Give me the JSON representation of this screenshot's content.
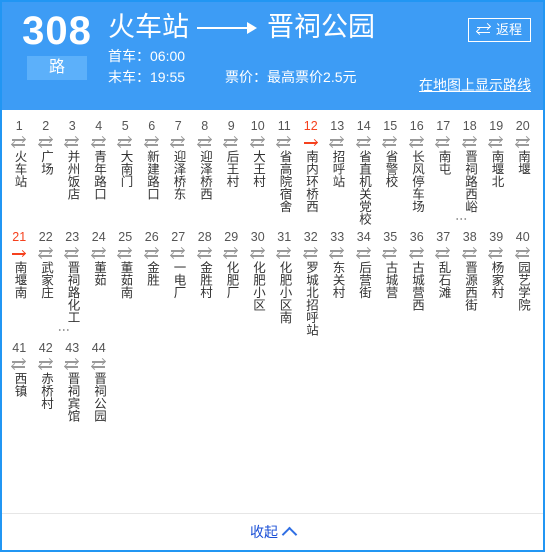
{
  "header": {
    "route_number": "308",
    "route_suffix": "路",
    "origin": "火车站",
    "destination": "晋祠公园",
    "direction_arrow_icon": "long-right-arrow-icon",
    "first_bus_label": "首车：06:00",
    "last_bus_label": "末车：19:55",
    "fare_label": "票价：最高票价2.5元",
    "return_button": {
      "label": "返程",
      "icon": "swap-icon"
    },
    "map_link_label": "在地图上显示路线",
    "background_color": "#3d9cf5",
    "text_color": "#ffffff"
  },
  "stations": {
    "current_color": "#f5411e",
    "normal_icon": "two-way-arrow-icon",
    "current_icon": "one-way-arrow-icon",
    "list": [
      {
        "num": "1",
        "name": "火车站",
        "current": false,
        "truncated": false
      },
      {
        "num": "2",
        "name": "广场",
        "current": false,
        "truncated": false
      },
      {
        "num": "3",
        "name": "并州饭店",
        "current": false,
        "truncated": false
      },
      {
        "num": "4",
        "name": "青年路口",
        "current": false,
        "truncated": false
      },
      {
        "num": "5",
        "name": "大南门",
        "current": false,
        "truncated": false
      },
      {
        "num": "6",
        "name": "新建路口",
        "current": false,
        "truncated": false
      },
      {
        "num": "7",
        "name": "迎泽桥东",
        "current": false,
        "truncated": false
      },
      {
        "num": "8",
        "name": "迎泽桥西",
        "current": false,
        "truncated": false
      },
      {
        "num": "9",
        "name": "后王村",
        "current": false,
        "truncated": false
      },
      {
        "num": "10",
        "name": "大王村",
        "current": false,
        "truncated": false
      },
      {
        "num": "11",
        "name": "省高院宿舍",
        "current": false,
        "truncated": false
      },
      {
        "num": "12",
        "name": "南内环桥西",
        "current": true,
        "truncated": false
      },
      {
        "num": "13",
        "name": "招呼站",
        "current": false,
        "truncated": false
      },
      {
        "num": "14",
        "name": "省直机关党校",
        "current": false,
        "truncated": false
      },
      {
        "num": "15",
        "name": "省警校",
        "current": false,
        "truncated": false
      },
      {
        "num": "16",
        "name": "长风停车场",
        "current": false,
        "truncated": false
      },
      {
        "num": "17",
        "name": "南屯",
        "current": false,
        "truncated": false
      },
      {
        "num": "18",
        "name": "晋祠路西峪",
        "current": false,
        "truncated": true
      },
      {
        "num": "19",
        "name": "南堰北",
        "current": false,
        "truncated": false
      },
      {
        "num": "20",
        "name": "南堰",
        "current": false,
        "truncated": false
      },
      {
        "num": "21",
        "name": "南堰南",
        "current": true,
        "truncated": false
      },
      {
        "num": "22",
        "name": "武家庄",
        "current": false,
        "truncated": false
      },
      {
        "num": "23",
        "name": "晋祠路化工",
        "current": false,
        "truncated": true
      },
      {
        "num": "24",
        "name": "董茹",
        "current": false,
        "truncated": false
      },
      {
        "num": "25",
        "name": "董茹南",
        "current": false,
        "truncated": false
      },
      {
        "num": "26",
        "name": "金胜",
        "current": false,
        "truncated": false
      },
      {
        "num": "27",
        "name": "一电厂",
        "current": false,
        "truncated": false
      },
      {
        "num": "28",
        "name": "金胜村",
        "current": false,
        "truncated": false
      },
      {
        "num": "29",
        "name": "化肥厂",
        "current": false,
        "truncated": false
      },
      {
        "num": "30",
        "name": "化肥小区",
        "current": false,
        "truncated": false
      },
      {
        "num": "31",
        "name": "化肥小区南",
        "current": false,
        "truncated": false
      },
      {
        "num": "32",
        "name": "罗城北招呼站",
        "current": false,
        "truncated": false
      },
      {
        "num": "33",
        "name": "东关村",
        "current": false,
        "truncated": false
      },
      {
        "num": "34",
        "name": "后营街",
        "current": false,
        "truncated": false
      },
      {
        "num": "35",
        "name": "古城营",
        "current": false,
        "truncated": false
      },
      {
        "num": "36",
        "name": "古城营西",
        "current": false,
        "truncated": false
      },
      {
        "num": "37",
        "name": "乱石滩",
        "current": false,
        "truncated": false
      },
      {
        "num": "38",
        "name": "晋源西街",
        "current": false,
        "truncated": false
      },
      {
        "num": "39",
        "name": "杨家村",
        "current": false,
        "truncated": false
      },
      {
        "num": "40",
        "name": "园艺学院",
        "current": false,
        "truncated": false
      },
      {
        "num": "41",
        "name": "西镇",
        "current": false,
        "truncated": false
      },
      {
        "num": "42",
        "name": "赤桥村",
        "current": false,
        "truncated": false
      },
      {
        "num": "43",
        "name": "晋祠宾馆",
        "current": false,
        "truncated": false
      },
      {
        "num": "44",
        "name": "晋祠公园",
        "current": false,
        "truncated": false
      }
    ]
  },
  "footer": {
    "collapse_label": "收起",
    "chevron_icon": "chevron-up-icon"
  }
}
